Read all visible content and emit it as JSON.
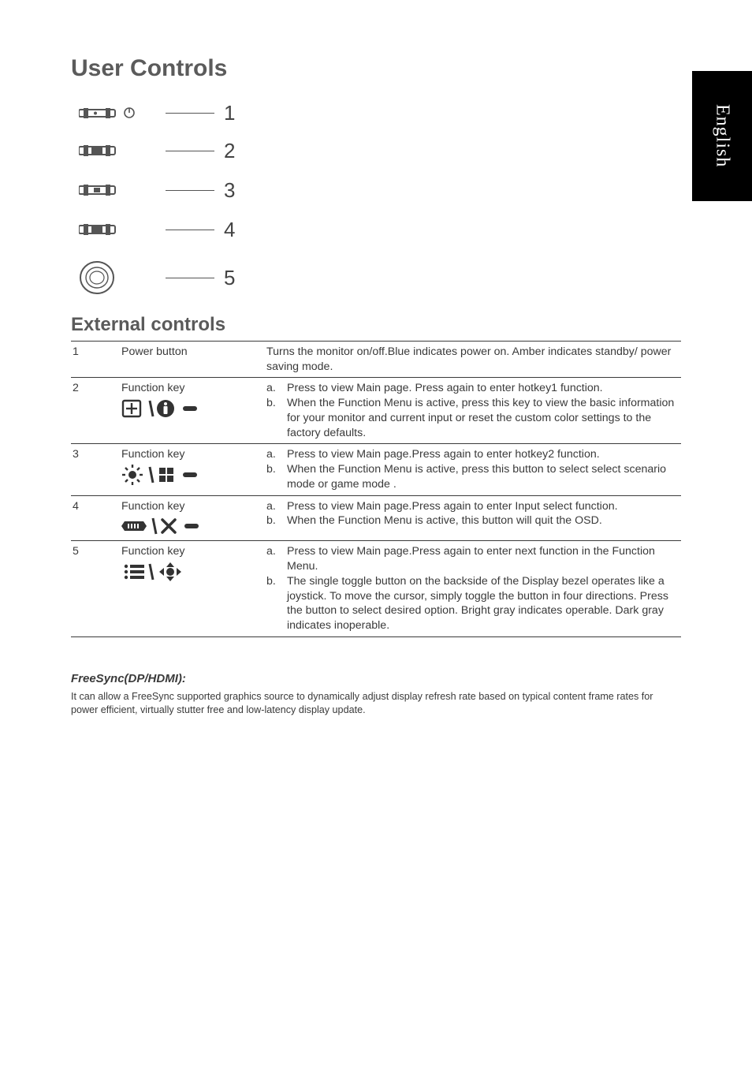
{
  "sideTab": "English",
  "title": "User Controls",
  "subtitle": "External controls",
  "diagram": {
    "n1": "1",
    "n2": "2",
    "n3": "3",
    "n4": "4",
    "n5": "5"
  },
  "rows": [
    {
      "num": "1",
      "key": "Power button",
      "desc_plain": "Turns the monitor on/off.Blue indicates power on. Amber indicates standby/ power saving mode."
    },
    {
      "num": "2",
      "key": "Function key",
      "items": [
        {
          "l": "a.",
          "t": "Press to view Main page. Press again to enter hotkey1 function."
        },
        {
          "l": "b.",
          "t": "When the Function Menu is active, press this key to view the basic information for your monitor and current input or reset the custom color settings to the factory defaults."
        }
      ]
    },
    {
      "num": "3",
      "key": "Function key",
      "items": [
        {
          "l": "a.",
          "t": "Press to view Main page.Press again to enter hotkey2 function."
        },
        {
          "l": "b.",
          "t": "When the Function Menu is active, press this button to select select scenario mode or game mode ."
        }
      ]
    },
    {
      "num": "4",
      "key": "Function key",
      "items": [
        {
          "l": "a.",
          "t": "Press to view Main page.Press again to enter Input select function."
        },
        {
          "l": "b.",
          "t": "When the Function Menu is active, this button will quit the OSD."
        }
      ]
    },
    {
      "num": "5",
      "key": "Function key",
      "items": [
        {
          "l": "a.",
          "t_html": "Press to view <span class='mp'>Main page</span>.Press again to enter next function in the Function Menu."
        },
        {
          "l": "b.",
          "t": "The single toggle button on the backside of the Display bezel operates like a joystick. To move the cursor, simply toggle the button in four directions. Press the button to select desired option. Bright gray indicates operable. Dark gray indicates inoperable."
        }
      ]
    }
  ],
  "freesync": {
    "heading": "FreeSync(DP/HDMI):",
    "body": "It can allow a FreeSync supported graphics source to dynamically adjust display refresh rate based on typical content frame rates for power efficient, virtually stutter free and low-latency display update."
  }
}
